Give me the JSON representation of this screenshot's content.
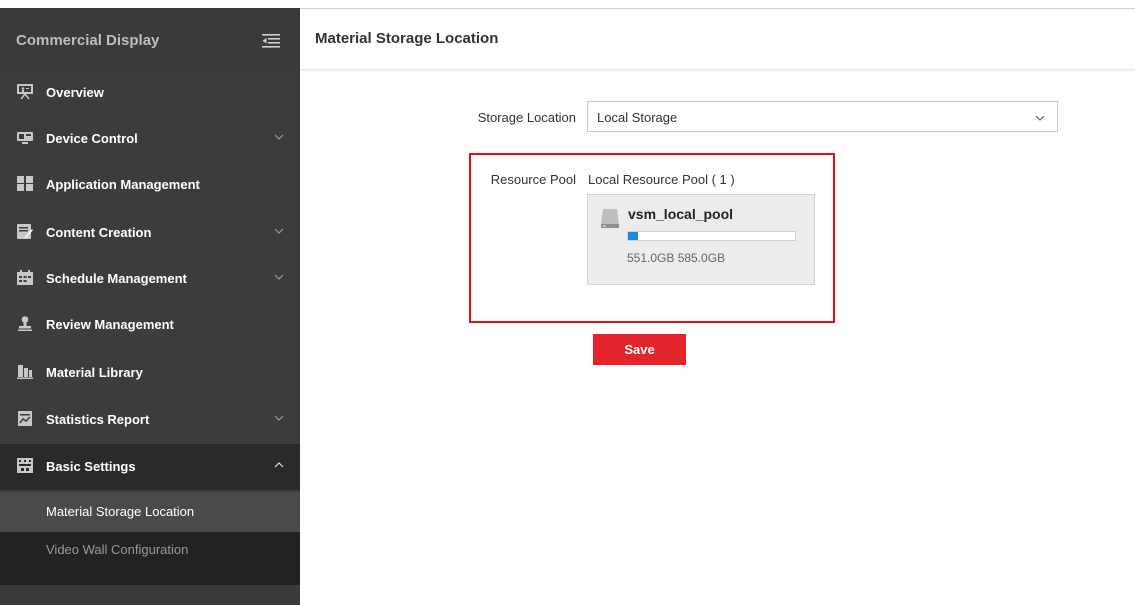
{
  "sidebar": {
    "title": "Commercial Display",
    "items": [
      {
        "label": "Overview",
        "icon": "presentation-icon",
        "expandable": false
      },
      {
        "label": "Device Control",
        "icon": "device-icon",
        "expandable": true
      },
      {
        "label": "Application Management",
        "icon": "apps-icon",
        "expandable": false
      },
      {
        "label": "Content Creation",
        "icon": "edit-icon",
        "expandable": true
      },
      {
        "label": "Schedule Management",
        "icon": "calendar-icon",
        "expandable": true
      },
      {
        "label": "Review Management",
        "icon": "stamp-icon",
        "expandable": false
      },
      {
        "label": "Material Library",
        "icon": "library-icon",
        "expandable": false
      },
      {
        "label": "Statistics Report",
        "icon": "report-icon",
        "expandable": true
      },
      {
        "label": "Basic Settings",
        "icon": "settings-icon",
        "expandable": true,
        "expanded": true
      }
    ],
    "subitems": [
      {
        "label": "Material Storage Location",
        "active": true
      },
      {
        "label": "Video Wall Configuration",
        "active": false
      }
    ]
  },
  "main": {
    "title": "Material Storage Location",
    "storage_location_label": "Storage Location",
    "storage_location_value": "Local Storage",
    "resource_pool_label": "Resource Pool",
    "resource_pool_title": "Local Resource Pool ( 1 )",
    "pool": {
      "name": "vsm_local_pool",
      "size_text": "551.0GB 585.0GB",
      "usage_fraction": 0.06
    },
    "save_label": "Save"
  },
  "colors": {
    "sidebar_bg": "#3c3c3c",
    "accent_red": "#e3242b",
    "highlight_border": "#e3101a",
    "progress_blue": "#1e88e5"
  }
}
